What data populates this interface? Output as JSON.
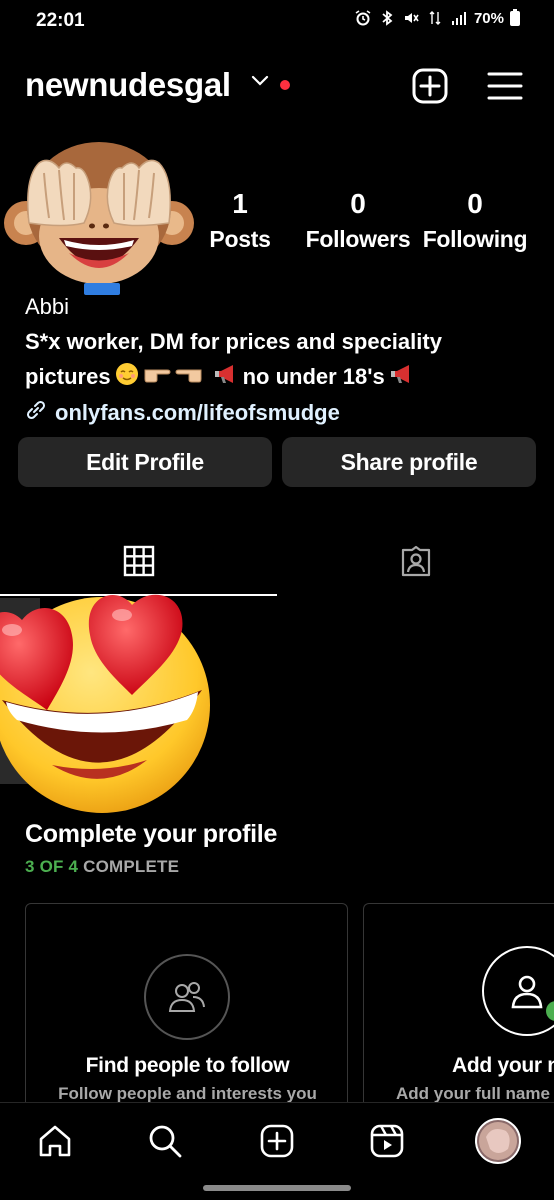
{
  "status_bar": {
    "time": "22:01",
    "battery": "70%"
  },
  "header": {
    "username": "newnudesgal"
  },
  "stats": [
    {
      "value": "1",
      "label": "Posts"
    },
    {
      "value": "0",
      "label": "Followers"
    },
    {
      "value": "0",
      "label": "Following"
    }
  ],
  "bio": {
    "name": "Abbi",
    "line1": "S*x worker, DM for prices and speciality",
    "line2_a": "pictures",
    "line2_b": "no under 18's",
    "link": "onlyfans.com/lifeofsmudge"
  },
  "buttons": {
    "edit": "Edit Profile",
    "share": "Share profile"
  },
  "complete": {
    "title": "Complete your profile",
    "progress_green": "3 OF 4",
    "progress_rest": " COMPLETE"
  },
  "cards": [
    {
      "title": "Find people to follow",
      "desc": "Follow people and interests you"
    },
    {
      "title": "Add your n",
      "desc": "Add your full name"
    }
  ],
  "colors": {
    "accent_red": "#ff3040",
    "progress_green": "#4caf50",
    "button_bg": "#262626"
  }
}
